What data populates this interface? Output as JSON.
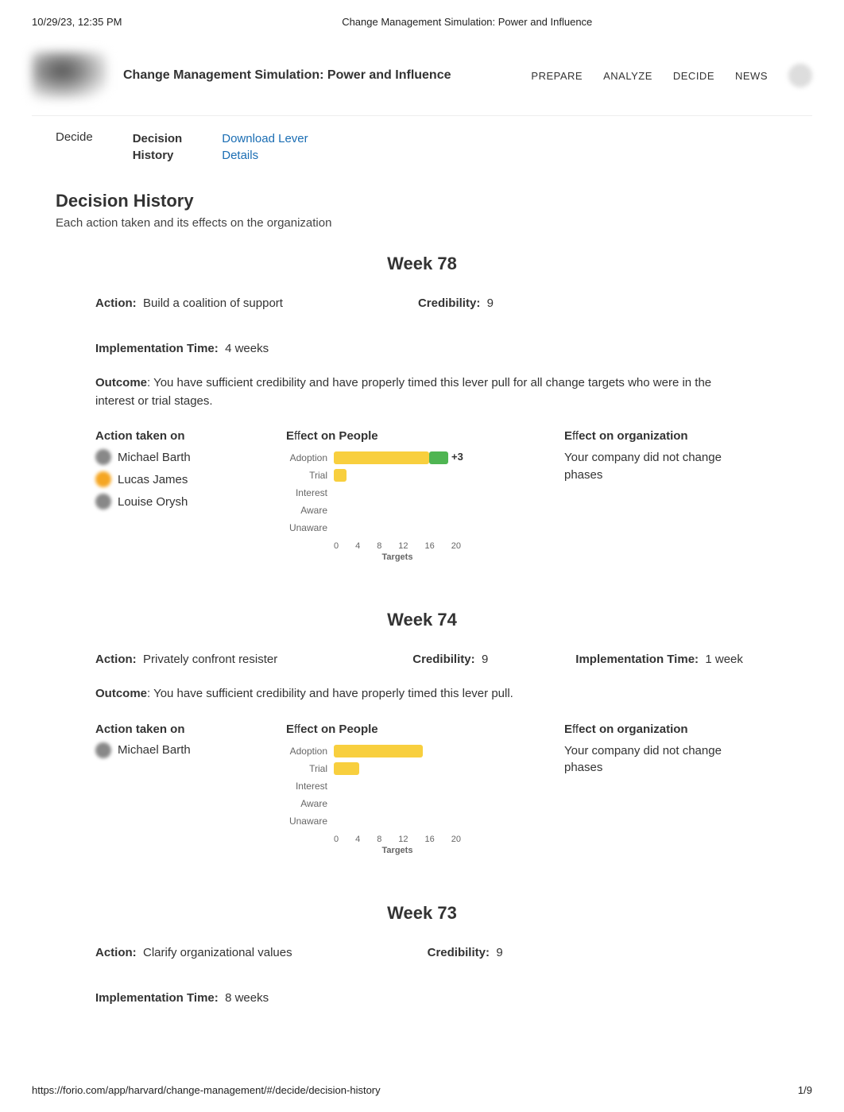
{
  "print": {
    "timestamp": "10/29/23, 12:35 PM",
    "doc_title": "Change Management Simulation: Power and Influence",
    "url": "https://forio.com/app/harvard/change-management/#/decide/decision-history",
    "page": "1/9"
  },
  "header": {
    "app_title": "Change Management Simulation: Power and Influence",
    "nav": [
      "PREPARE",
      "ANALYZE",
      "DECIDE",
      "NEWS"
    ]
  },
  "subnav": {
    "decide": "Decide",
    "history_l1": "Decision",
    "history_l2": "History",
    "download_l1": "Download Lever",
    "download_l2": "Details"
  },
  "page": {
    "title": "Decision History",
    "subtitle": "Each action taken and its effects on the organization"
  },
  "labels": {
    "action": "Action:",
    "credibility": "Credibility:",
    "impl_time": "Implementation Time:",
    "outcome": "Outcome",
    "action_on": "Action taken on",
    "eff_people_pre": "E",
    "eff_people_mid": "ff",
    "eff_people_post": "ect on People",
    "eff_org_pre": "E",
    "eff_org_mid": "ff",
    "eff_org_post": "ect on organization",
    "targets": "Targets"
  },
  "chart_axes": {
    "y": [
      "Adoption",
      "Trial",
      "Interest",
      "Aware",
      "Unaware"
    ],
    "x": [
      "0",
      "4",
      "8",
      "12",
      "16",
      "20"
    ]
  },
  "weeks": [
    {
      "title": "Week 78",
      "action": "Build a coalition of support",
      "credibility": "9",
      "impl_time": "4 weeks",
      "outcome": ": You have sufficient credibility and have properly timed this lever pull for all change targets who were in the interest or trial stages.",
      "people": [
        {
          "name": "Michael Barth",
          "color": "grey"
        },
        {
          "name": "Lucas James",
          "color": "orange"
        },
        {
          "name": "Louise Orysh",
          "color": "grey"
        }
      ],
      "org_effect": "Your company did not change phases",
      "chart_annot": "+3"
    },
    {
      "title": "Week 74",
      "action": "Privately confront resister",
      "credibility": "9",
      "impl_time": "1 week",
      "outcome": ": You have sufficient credibility and have properly timed this lever pull.",
      "people": [
        {
          "name": "Michael Barth",
          "color": "grey"
        }
      ],
      "org_effect": "Your company did not change phases",
      "chart_annot": ""
    },
    {
      "title": "Week 73",
      "action": "Clarify organizational values",
      "credibility": "9",
      "impl_time": "8 weeks",
      "outcome": "",
      "people": [],
      "org_effect": "",
      "chart_annot": ""
    }
  ],
  "chart_data": [
    {
      "type": "bar",
      "title": "Effect on People — Week 78",
      "xlabel": "Targets",
      "ylabel": "",
      "xlim": [
        0,
        20
      ],
      "categories": [
        "Adoption",
        "Trial",
        "Interest",
        "Aware",
        "Unaware"
      ],
      "series": [
        {
          "name": "previous",
          "color": "#f8cf3e",
          "values": [
            15,
            2,
            0,
            0,
            0
          ]
        },
        {
          "name": "change",
          "color": "#4fb552",
          "values": [
            3,
            0,
            0,
            0,
            0
          ]
        }
      ],
      "annotations": [
        {
          "category": "Adoption",
          "text": "+3"
        }
      ]
    },
    {
      "type": "bar",
      "title": "Effect on People — Week 74",
      "xlabel": "Targets",
      "ylabel": "",
      "xlim": [
        0,
        20
      ],
      "categories": [
        "Adoption",
        "Trial",
        "Interest",
        "Aware",
        "Unaware"
      ],
      "series": [
        {
          "name": "previous",
          "color": "#f8cf3e",
          "values": [
            14,
            4,
            0,
            0,
            0
          ]
        }
      ],
      "annotations": []
    }
  ]
}
